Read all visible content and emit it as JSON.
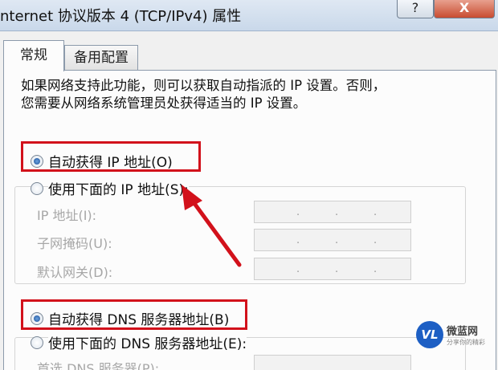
{
  "window": {
    "title": "nternet 协议版本 4 (TCP/IPv4) 属性",
    "help_label": "?",
    "close_label": "X"
  },
  "tabs": [
    {
      "label": "常规",
      "selected": true
    },
    {
      "label": "备用配置",
      "selected": false
    }
  ],
  "description": {
    "line1": "如果网络支持此功能，则可以获取自动指派的 IP 设置。否则，",
    "line2": "您需要从网络系统管理员处获得适当的 IP 设置。"
  },
  "ip_options": {
    "auto_label": "自动获得 IP 地址(O)",
    "auto_selected": true,
    "manual_label": "使用下面的 IP 地址(S):",
    "manual_selected": false,
    "fields": [
      {
        "label": "IP 地址(I):",
        "dots": [
          ".",
          ".",
          "."
        ]
      },
      {
        "label": "子网掩码(U):",
        "dots": [
          ".",
          ".",
          "."
        ]
      },
      {
        "label": "默认网关(D):",
        "dots": [
          ".",
          ".",
          "."
        ]
      }
    ]
  },
  "dns_options": {
    "auto_label": "自动获得 DNS 服务器地址(B)",
    "auto_selected": true,
    "manual_label": "使用下面的 DNS 服务器地址(E):",
    "manual_selected": false,
    "preferred_label": "首选 DNS 服务器(P):"
  },
  "watermark": {
    "logo_text": "VL",
    "name": "微蓝网",
    "sub": "分享你的精彩"
  },
  "colors": {
    "highlight": "#d2111b",
    "arrow": "#d2111b",
    "titlebar": "#c9d8ea"
  }
}
